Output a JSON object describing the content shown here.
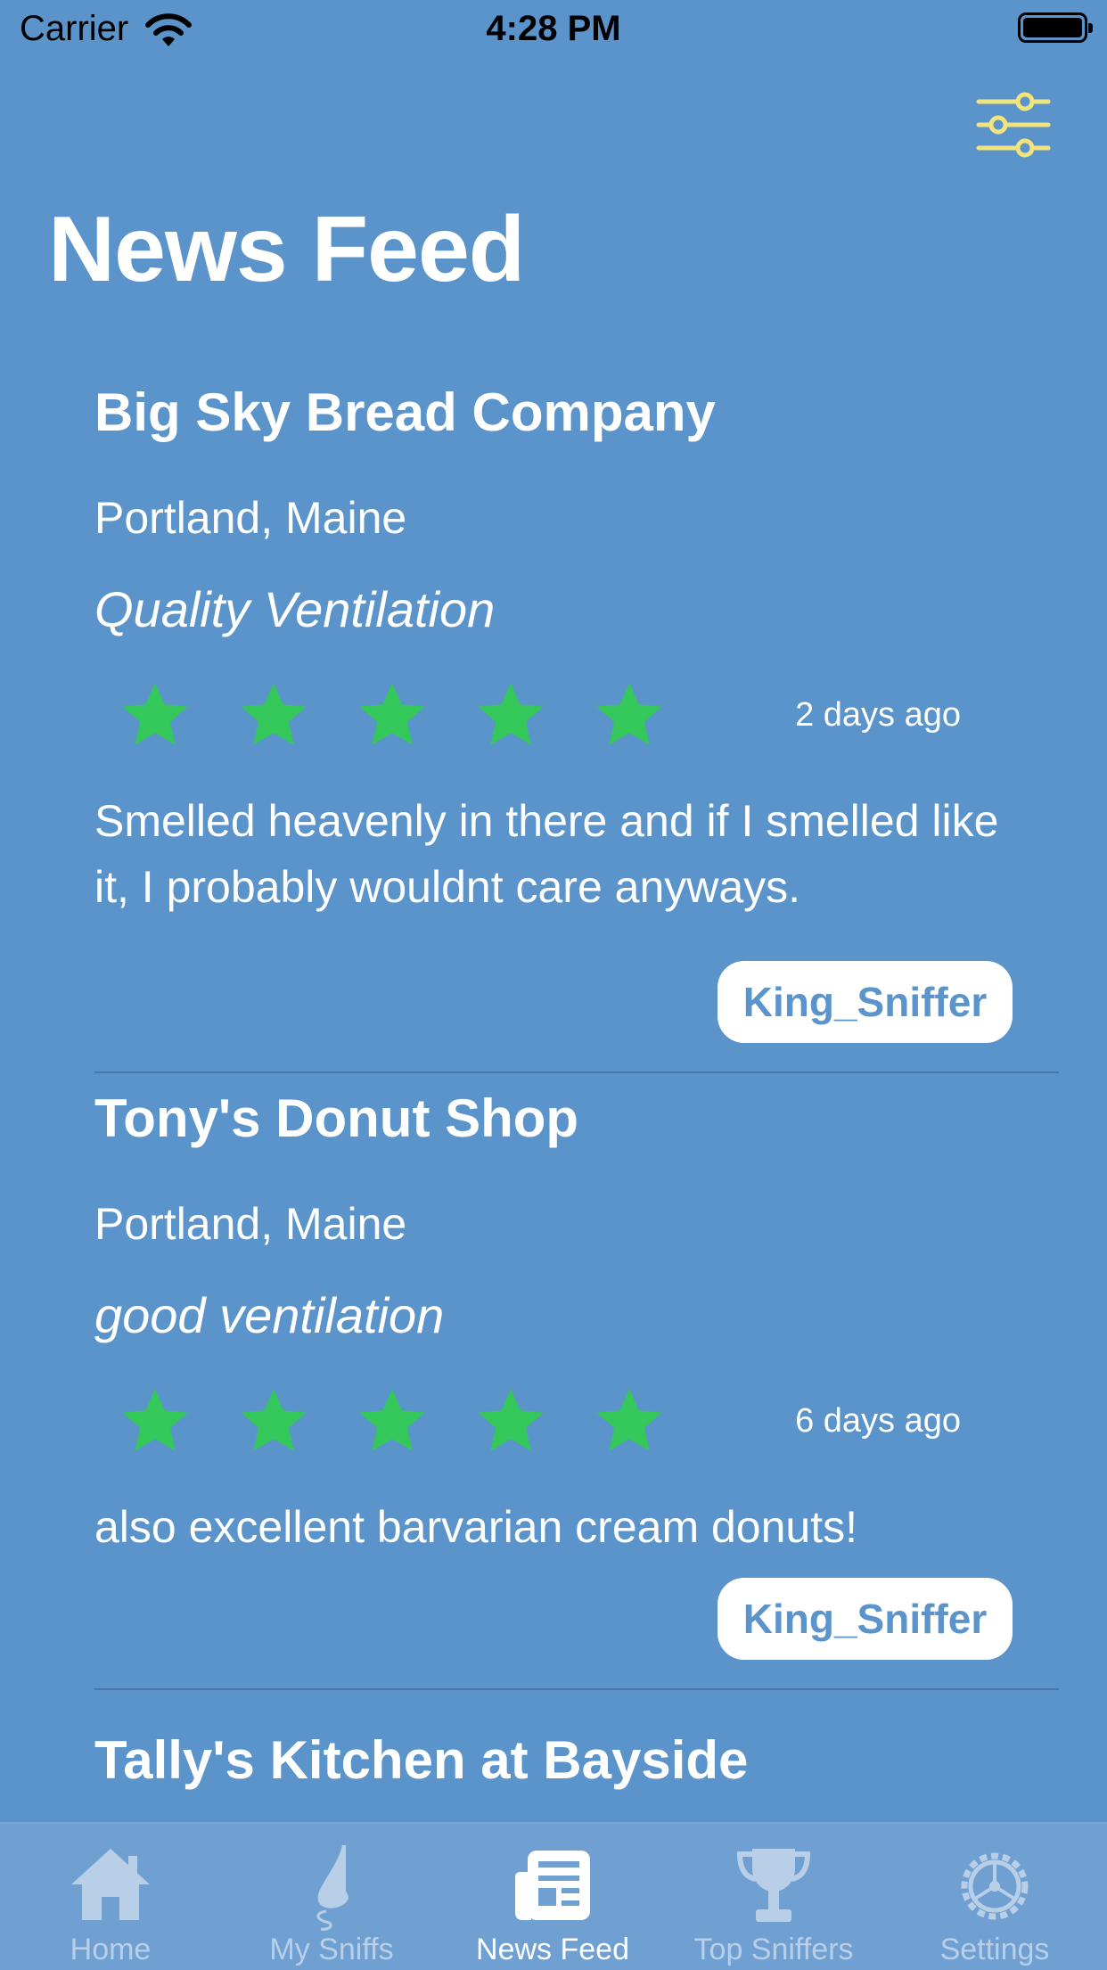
{
  "status_bar": {
    "carrier": "Carrier",
    "time": "4:28 PM",
    "battery_level": 0.92
  },
  "header": {
    "title": "News Feed",
    "filter_icon": "sliders-icon"
  },
  "colors": {
    "background": "#5b94cb",
    "star": "#34c85a",
    "filter_icon": "#f1e47c",
    "tab_active": "#ffffff",
    "tab_inactive": "#b9cfe8"
  },
  "posts": [
    {
      "venue": "Big Sky Bread Company",
      "location": "Portland, Maine",
      "headline": "Quality Ventilation",
      "rating": 5,
      "time_ago": "2 days ago",
      "review": "Smelled heavenly in there and if I smelled like it, I probably wouldnt care anyways.",
      "user": "King_Sniffer"
    },
    {
      "venue": "Tony's Donut Shop",
      "location": "Portland, Maine",
      "headline": "good ventilation",
      "rating": 5,
      "time_ago": "6 days ago",
      "review": "also excellent barvarian cream donuts!",
      "user": "King_Sniffer"
    },
    {
      "venue": "Tally's Kitchen at Bayside"
    }
  ],
  "tabs": [
    {
      "label": "Home",
      "icon": "house-icon",
      "active": false
    },
    {
      "label": "My Sniffs",
      "icon": "nose-icon",
      "active": false
    },
    {
      "label": "News Feed",
      "icon": "newspaper-icon",
      "active": true
    },
    {
      "label": "Top Sniffers",
      "icon": "trophy-icon",
      "active": false
    },
    {
      "label": "Settings",
      "icon": "gear-icon",
      "active": false
    }
  ]
}
